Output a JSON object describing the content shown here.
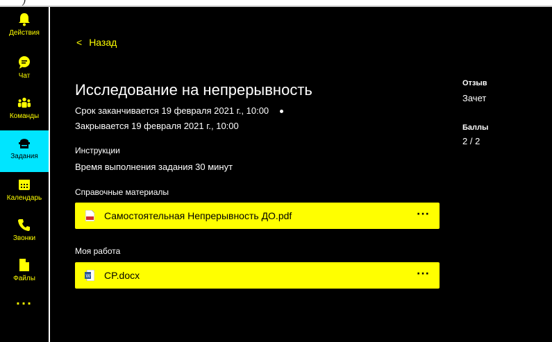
{
  "sidebar": {
    "items": [
      {
        "label": "Действия",
        "icon": "bell-icon"
      },
      {
        "label": "Чат",
        "icon": "chat-icon"
      },
      {
        "label": "Команды",
        "icon": "teams-icon"
      },
      {
        "label": "Задания",
        "icon": "assignments-icon",
        "active": true
      },
      {
        "label": "Календарь",
        "icon": "calendar-icon"
      },
      {
        "label": "Звонки",
        "icon": "phone-icon"
      },
      {
        "label": "Файлы",
        "icon": "file-icon"
      }
    ],
    "more_label": "···"
  },
  "main": {
    "back_label": "Назад",
    "title": "Исследование на непрерывность",
    "due_text": "Срок заканчивается 19 февраля 2021 г., 10:00",
    "closes_text": "Закрывается 19 февраля 2021 г., 10:00",
    "instructions_label": "Инструкции",
    "instructions_text": "Время выполнения задания 30 минут",
    "reference_label": "Справочные материалы",
    "reference_file": "Самостоятельная Непрерывность ДО.pdf",
    "my_work_label": "Моя работа",
    "my_work_file": "CP.docx",
    "more_dots": "···"
  },
  "right": {
    "feedback_label": "Отзыв",
    "feedback_value": "Зачет",
    "points_label": "Баллы",
    "points_value": "2 / 2"
  },
  "colors": {
    "accent": "#ffff00",
    "active_bg": "#00e5ff",
    "background": "#000000"
  }
}
